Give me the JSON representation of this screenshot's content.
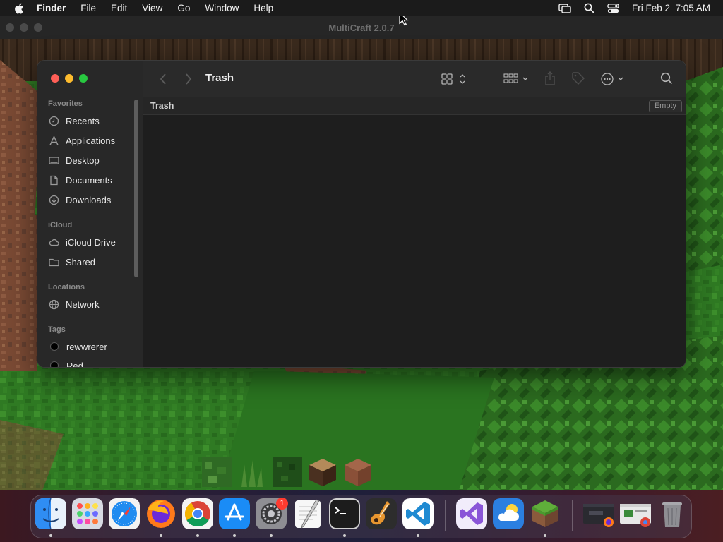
{
  "menubar": {
    "app_name": "Finder",
    "menus": [
      "File",
      "Edit",
      "View",
      "Go",
      "Window",
      "Help"
    ],
    "datetime": "Fri Feb 2  7:05 AM"
  },
  "game_window": {
    "title": "MultiCraft 2.0.7",
    "hotbar": [
      "grass-block",
      "tall-grass",
      "leaves-block",
      "oak-log",
      "dirt-block"
    ]
  },
  "finder": {
    "title": "Trash",
    "path_label": "Trash",
    "empty_button": "Empty",
    "sidebar": {
      "favorites_header": "Favorites",
      "favorites": [
        {
          "label": "Recents",
          "icon": "clock-icon"
        },
        {
          "label": "Applications",
          "icon": "applications-icon"
        },
        {
          "label": "Desktop",
          "icon": "desktop-icon"
        },
        {
          "label": "Documents",
          "icon": "document-icon"
        },
        {
          "label": "Downloads",
          "icon": "download-icon"
        }
      ],
      "icloud_header": "iCloud",
      "icloud": [
        {
          "label": "iCloud Drive",
          "icon": "cloud-icon"
        },
        {
          "label": "Shared",
          "icon": "shared-folder-icon"
        }
      ],
      "locations_header": "Locations",
      "locations": [
        {
          "label": "Network",
          "icon": "globe-icon"
        }
      ],
      "tags_header": "Tags",
      "tags": [
        {
          "label": "rewwrerer",
          "color": "#000000"
        },
        {
          "label": "Red",
          "color": "#000000"
        }
      ]
    }
  },
  "dock": {
    "apps": [
      "Finder",
      "Launchpad",
      "Safari",
      "Firefox",
      "Google Chrome",
      "App Store",
      "System Settings",
      "TextEdit",
      "Terminal",
      "GarageBand",
      "Visual Studio Code",
      "Visual Studio",
      "Weather",
      "MultiCraft"
    ],
    "settings_badge": "1",
    "trash": "Trash"
  }
}
